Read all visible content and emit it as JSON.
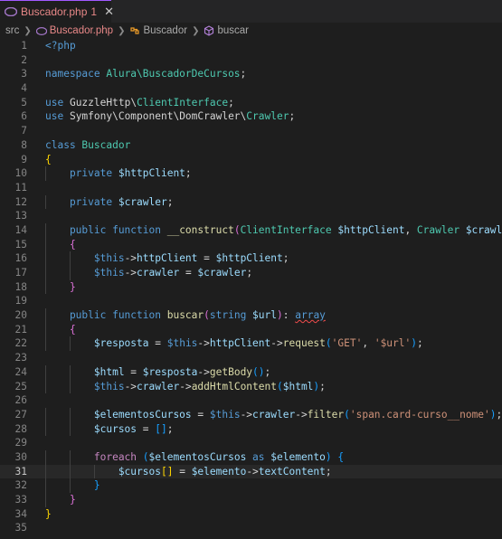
{
  "tab": {
    "filename": "Buscador.php",
    "badge": "1"
  },
  "breadcrumb": {
    "folder": "src",
    "file": "Buscador.php",
    "class": "Buscador",
    "method": "buscar"
  },
  "editor": {
    "current_line": 31,
    "line_numbers": [
      "1",
      "2",
      "3",
      "4",
      "5",
      "6",
      "7",
      "8",
      "9",
      "10",
      "11",
      "12",
      "13",
      "14",
      "15",
      "16",
      "17",
      "18",
      "19",
      "20",
      "21",
      "22",
      "23",
      "24",
      "25",
      "26",
      "27",
      "28",
      "29",
      "30",
      "31",
      "32",
      "33",
      "34",
      "35"
    ],
    "lines": [
      [
        {
          "t": "<?php",
          "c": "tag"
        }
      ],
      [],
      [
        {
          "t": "namespace ",
          "c": "kw"
        },
        {
          "t": "Alura\\BuscadorDeCursos",
          "c": "ns"
        },
        {
          "t": ";",
          "c": "op"
        }
      ],
      [],
      [
        {
          "t": "use ",
          "c": "kw"
        },
        {
          "t": "GuzzleHttp",
          "c": "op"
        },
        {
          "t": "\\",
          "c": "op"
        },
        {
          "t": "ClientInterface",
          "c": "cls"
        },
        {
          "t": ";",
          "c": "op"
        }
      ],
      [
        {
          "t": "use ",
          "c": "kw"
        },
        {
          "t": "Symfony\\Component\\DomCrawler\\",
          "c": "op"
        },
        {
          "t": "Crawler",
          "c": "cls"
        },
        {
          "t": ";",
          "c": "op"
        }
      ],
      [],
      [
        {
          "t": "class ",
          "c": "kw"
        },
        {
          "t": "Buscador",
          "c": "cls"
        }
      ],
      [
        {
          "t": "{",
          "c": "b1"
        }
      ],
      [
        {
          "t": "    private ",
          "c": "kw"
        },
        {
          "t": "$httpClient",
          "c": "var"
        },
        {
          "t": ";",
          "c": "op"
        }
      ],
      [],
      [
        {
          "t": "    private ",
          "c": "kw"
        },
        {
          "t": "$crawler",
          "c": "var"
        },
        {
          "t": ";",
          "c": "op"
        }
      ],
      [],
      [
        {
          "t": "    public function ",
          "c": "kw"
        },
        {
          "t": "__construct",
          "c": "fn"
        },
        {
          "t": "(",
          "c": "b2"
        },
        {
          "t": "ClientInterface ",
          "c": "cls"
        },
        {
          "t": "$httpClient",
          "c": "var"
        },
        {
          "t": ", ",
          "c": "op"
        },
        {
          "t": "Crawler ",
          "c": "cls"
        },
        {
          "t": "$crawler",
          "c": "var"
        },
        {
          "t": ")",
          "c": "b2"
        }
      ],
      [
        {
          "t": "    {",
          "c": "b2"
        }
      ],
      [
        {
          "t": "        $this",
          "c": "kw"
        },
        {
          "t": "->",
          "c": "op"
        },
        {
          "t": "httpClient",
          "c": "var"
        },
        {
          "t": " = ",
          "c": "op"
        },
        {
          "t": "$httpClient",
          "c": "var"
        },
        {
          "t": ";",
          "c": "op"
        }
      ],
      [
        {
          "t": "        $this",
          "c": "kw"
        },
        {
          "t": "->",
          "c": "op"
        },
        {
          "t": "crawler",
          "c": "var"
        },
        {
          "t": " = ",
          "c": "op"
        },
        {
          "t": "$crawler",
          "c": "var"
        },
        {
          "t": ";",
          "c": "op"
        }
      ],
      [
        {
          "t": "    }",
          "c": "b2"
        }
      ],
      [],
      [
        {
          "t": "    public function ",
          "c": "kw"
        },
        {
          "t": "buscar",
          "c": "fn"
        },
        {
          "t": "(",
          "c": "b2"
        },
        {
          "t": "string ",
          "c": "kw"
        },
        {
          "t": "$url",
          "c": "var"
        },
        {
          "t": ")",
          "c": "b2"
        },
        {
          "t": ": ",
          "c": "op"
        },
        {
          "t": "array",
          "c": "kw squig"
        }
      ],
      [
        {
          "t": "    {",
          "c": "b2"
        }
      ],
      [
        {
          "t": "        $resposta",
          "c": "var"
        },
        {
          "t": " = ",
          "c": "op"
        },
        {
          "t": "$this",
          "c": "kw"
        },
        {
          "t": "->",
          "c": "op"
        },
        {
          "t": "httpClient",
          "c": "var"
        },
        {
          "t": "->",
          "c": "op"
        },
        {
          "t": "request",
          "c": "fn"
        },
        {
          "t": "(",
          "c": "b3"
        },
        {
          "t": "'GET'",
          "c": "str"
        },
        {
          "t": ", ",
          "c": "op"
        },
        {
          "t": "'$url'",
          "c": "str"
        },
        {
          "t": ")",
          "c": "b3"
        },
        {
          "t": ";",
          "c": "op"
        }
      ],
      [],
      [
        {
          "t": "        $html",
          "c": "var"
        },
        {
          "t": " = ",
          "c": "op"
        },
        {
          "t": "$resposta",
          "c": "var"
        },
        {
          "t": "->",
          "c": "op"
        },
        {
          "t": "getBody",
          "c": "fn"
        },
        {
          "t": "()",
          "c": "b3"
        },
        {
          "t": ";",
          "c": "op"
        }
      ],
      [
        {
          "t": "        $this",
          "c": "kw"
        },
        {
          "t": "->",
          "c": "op"
        },
        {
          "t": "crawler",
          "c": "var"
        },
        {
          "t": "->",
          "c": "op"
        },
        {
          "t": "addHtmlContent",
          "c": "fn"
        },
        {
          "t": "(",
          "c": "b3"
        },
        {
          "t": "$html",
          "c": "var"
        },
        {
          "t": ")",
          "c": "b3"
        },
        {
          "t": ";",
          "c": "op"
        }
      ],
      [],
      [
        {
          "t": "        $elementosCursos",
          "c": "var"
        },
        {
          "t": " = ",
          "c": "op"
        },
        {
          "t": "$this",
          "c": "kw"
        },
        {
          "t": "->",
          "c": "op"
        },
        {
          "t": "crawler",
          "c": "var"
        },
        {
          "t": "->",
          "c": "op"
        },
        {
          "t": "filter",
          "c": "fn"
        },
        {
          "t": "(",
          "c": "b3"
        },
        {
          "t": "'span.card-curso__nome'",
          "c": "str"
        },
        {
          "t": ")",
          "c": "b3"
        },
        {
          "t": ";",
          "c": "op"
        }
      ],
      [
        {
          "t": "        $cursos",
          "c": "var"
        },
        {
          "t": " = ",
          "c": "op"
        },
        {
          "t": "[]",
          "c": "b3"
        },
        {
          "t": ";",
          "c": "op"
        }
      ],
      [],
      [
        {
          "t": "        foreach ",
          "c": "ctl"
        },
        {
          "t": "(",
          "c": "b3"
        },
        {
          "t": "$elementosCursos",
          "c": "var"
        },
        {
          "t": " as ",
          "c": "kw"
        },
        {
          "t": "$elemento",
          "c": "var"
        },
        {
          "t": ")",
          "c": "b3"
        },
        {
          "t": " {",
          "c": "b3"
        }
      ],
      [
        {
          "t": "            $cursos",
          "c": "var"
        },
        {
          "t": "[]",
          "c": "b1"
        },
        {
          "t": " = ",
          "c": "op"
        },
        {
          "t": "$elemento",
          "c": "var"
        },
        {
          "t": "->",
          "c": "op"
        },
        {
          "t": "textContent",
          "c": "var"
        },
        {
          "t": ";",
          "c": "op"
        }
      ],
      [
        {
          "t": "        }",
          "c": "b3"
        }
      ],
      [
        {
          "t": "    }",
          "c": "b2"
        }
      ],
      [
        {
          "t": "}",
          "c": "b1"
        }
      ],
      []
    ]
  }
}
